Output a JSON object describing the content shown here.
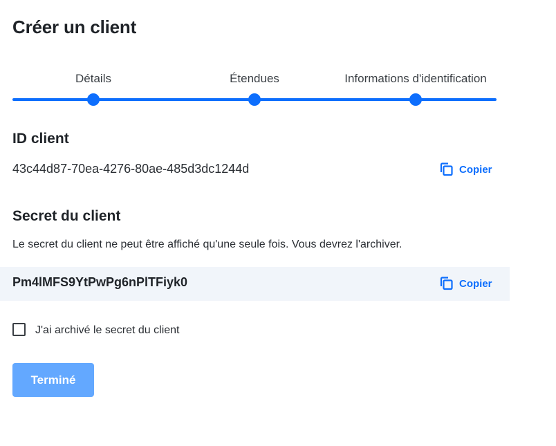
{
  "page": {
    "title": "Créer un client"
  },
  "stepper": {
    "steps": [
      {
        "label": "Détails"
      },
      {
        "label": "Étendues"
      },
      {
        "label": "Informations d'identification"
      }
    ],
    "accent_color": "#0d6efd"
  },
  "client_id": {
    "heading": "ID client",
    "value": "43c44d87-70ea-4276-80ae-485d3dc1244d",
    "copy_label": "Copier"
  },
  "client_secret": {
    "heading": "Secret du client",
    "description": "Le secret du client ne peut être affiché qu'une seule fois. Vous devrez l'archiver.",
    "value": "Pm4lMFS9YtPwPg6nPlTFiyk0",
    "copy_label": "Copier"
  },
  "archive_checkbox": {
    "label": "J'ai archivé le secret du client",
    "checked": false
  },
  "actions": {
    "done_label": "Terminé",
    "done_color": "#63a8ff"
  },
  "icons": {
    "copy": "copy-icon"
  }
}
